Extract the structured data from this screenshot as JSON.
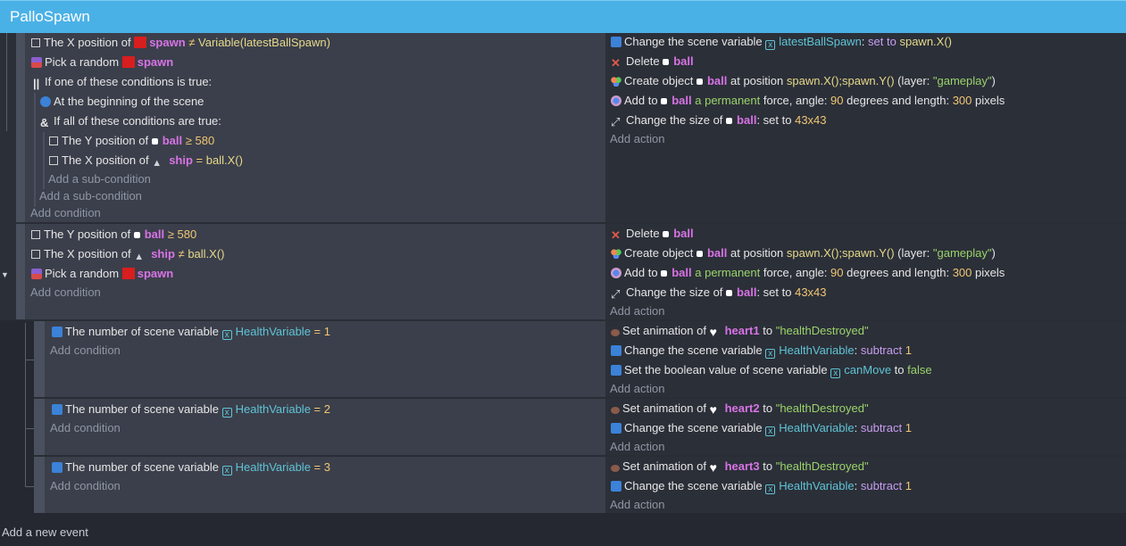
{
  "scene": {
    "title": "PalloSpawn"
  },
  "footer": {
    "add_event": "Add a new event"
  },
  "common": {
    "add_condition": "Add condition",
    "add_action": "Add action",
    "add_sub_condition": "Add a sub-condition"
  },
  "event1": {
    "c1": {
      "text": "The X position of",
      "obj": "spawn",
      "op": "≠",
      "val": "Variable(latestBallSpawn)"
    },
    "c2": {
      "text": "Pick a random",
      "obj": "spawn"
    },
    "c3": {
      "text": "If one of these conditions is true:"
    },
    "c4": {
      "text": "At the beginning of the scene"
    },
    "c5": {
      "text": "If all of these conditions are true:"
    },
    "c6": {
      "text": "The Y position of",
      "obj": "ball",
      "op": "≥",
      "val": "580"
    },
    "c7": {
      "text": "The X position of",
      "obj": "ship",
      "op": "=",
      "val": "ball.X()"
    },
    "a1": {
      "text": "Change the scene variable",
      "var": "latestBallSpawn",
      "mid": ":",
      "op": "set to",
      "val": "spawn.X()"
    },
    "a2": {
      "text": "Delete",
      "obj": "ball"
    },
    "a3": {
      "text": "Create object",
      "obj": "ball",
      "mid": "at position",
      "val": "spawn.X();spawn.Y()",
      "layer_pre": "(layer:",
      "layer": "\"gameplay\"",
      "layer_post": ")"
    },
    "a4": {
      "text": "Add to",
      "obj": "ball",
      "kind": "a permanent",
      "mid": "force, angle:",
      "angle": "90",
      "mid2": "degrees and length:",
      "len": "300",
      "post": "pixels"
    },
    "a5": {
      "text": "Change the size of",
      "obj": "ball",
      "mid": ": set to",
      "val": "43x43"
    }
  },
  "event2": {
    "c1": {
      "text": "The Y position of",
      "obj": "ball",
      "op": "≥",
      "val": "580"
    },
    "c2": {
      "text": "The X position of",
      "obj": "ship",
      "op": "≠",
      "val": "ball.X()"
    },
    "c3": {
      "text": "Pick a random",
      "obj": "spawn"
    },
    "a1": {
      "text": "Delete",
      "obj": "ball"
    },
    "a2": {
      "text": "Create object",
      "obj": "ball",
      "mid": "at position",
      "val": "spawn.X();spawn.Y()",
      "layer_pre": "(layer:",
      "layer": "\"gameplay\"",
      "layer_post": ")"
    },
    "a3": {
      "text": "Add to",
      "obj": "ball",
      "kind": "a permanent",
      "mid": "force, angle:",
      "angle": "90",
      "mid2": "degrees and length:",
      "len": "300",
      "post": "pixels"
    },
    "a4": {
      "text": "Change the size of",
      "obj": "ball",
      "mid": ": set to",
      "val": "43x43"
    }
  },
  "event3": {
    "c1": {
      "text": "The number of scene variable",
      "var": "HealthVariable",
      "op": "=",
      "val": "1"
    },
    "a1": {
      "text": "Set animation of",
      "obj": "heart1",
      "mid": "to",
      "val": "\"healthDestroyed\""
    },
    "a2": {
      "text": "Change the scene variable",
      "var": "HealthVariable",
      "mid": ":",
      "op": "subtract",
      "val": "1"
    },
    "a3": {
      "text": "Set the boolean value of scene variable",
      "var": "canMove",
      "mid": "to",
      "val": "false"
    }
  },
  "event4": {
    "c1": {
      "text": "The number of scene variable",
      "var": "HealthVariable",
      "op": "=",
      "val": "2"
    },
    "a1": {
      "text": "Set animation of",
      "obj": "heart2",
      "mid": "to",
      "val": "\"healthDestroyed\""
    },
    "a2": {
      "text": "Change the scene variable",
      "var": "HealthVariable",
      "mid": ":",
      "op": "subtract",
      "val": "1"
    }
  },
  "event5": {
    "c1": {
      "text": "The number of scene variable",
      "var": "HealthVariable",
      "op": "=",
      "val": "3"
    },
    "a1": {
      "text": "Set animation of",
      "obj": "heart3",
      "mid": "to",
      "val": "\"healthDestroyed\""
    },
    "a2": {
      "text": "Change the scene variable",
      "var": "HealthVariable",
      "mid": ":",
      "op": "subtract",
      "val": "1"
    }
  }
}
